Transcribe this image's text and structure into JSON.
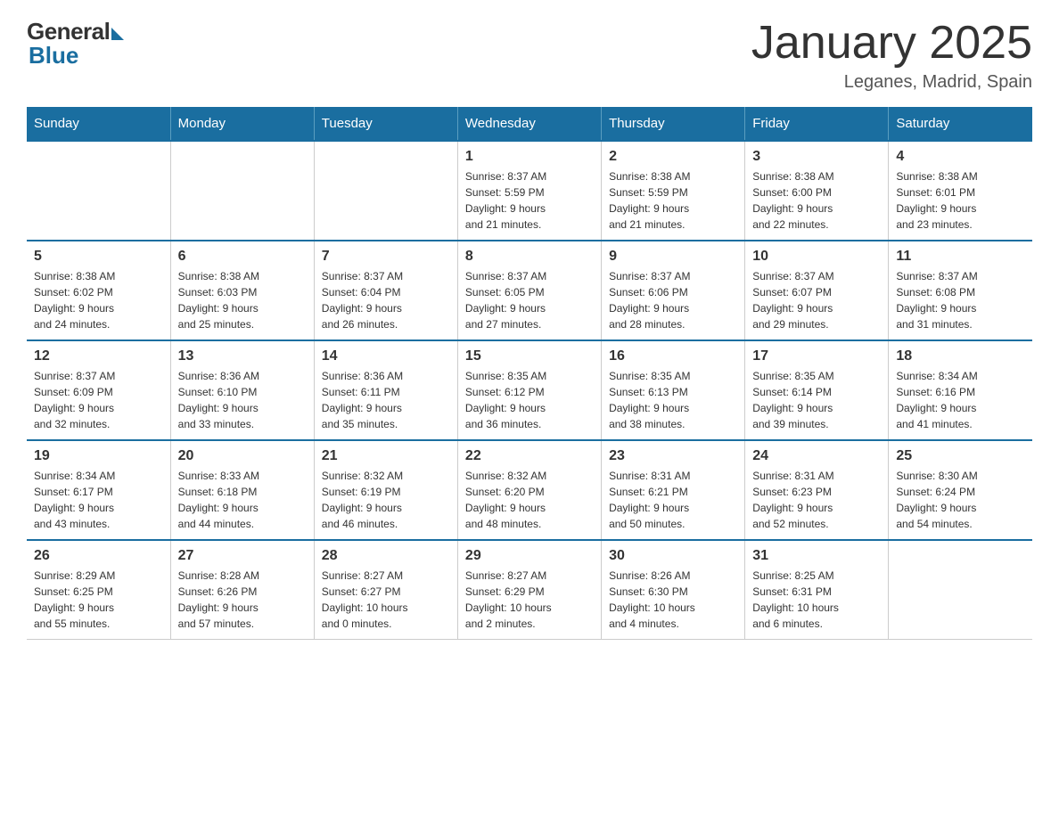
{
  "logo": {
    "general": "General",
    "blue": "Blue"
  },
  "title": "January 2025",
  "location": "Leganes, Madrid, Spain",
  "days_of_week": [
    "Sunday",
    "Monday",
    "Tuesday",
    "Wednesday",
    "Thursday",
    "Friday",
    "Saturday"
  ],
  "weeks": [
    [
      {
        "day": "",
        "info": ""
      },
      {
        "day": "",
        "info": ""
      },
      {
        "day": "",
        "info": ""
      },
      {
        "day": "1",
        "info": "Sunrise: 8:37 AM\nSunset: 5:59 PM\nDaylight: 9 hours\nand 21 minutes."
      },
      {
        "day": "2",
        "info": "Sunrise: 8:38 AM\nSunset: 5:59 PM\nDaylight: 9 hours\nand 21 minutes."
      },
      {
        "day": "3",
        "info": "Sunrise: 8:38 AM\nSunset: 6:00 PM\nDaylight: 9 hours\nand 22 minutes."
      },
      {
        "day": "4",
        "info": "Sunrise: 8:38 AM\nSunset: 6:01 PM\nDaylight: 9 hours\nand 23 minutes."
      }
    ],
    [
      {
        "day": "5",
        "info": "Sunrise: 8:38 AM\nSunset: 6:02 PM\nDaylight: 9 hours\nand 24 minutes."
      },
      {
        "day": "6",
        "info": "Sunrise: 8:38 AM\nSunset: 6:03 PM\nDaylight: 9 hours\nand 25 minutes."
      },
      {
        "day": "7",
        "info": "Sunrise: 8:37 AM\nSunset: 6:04 PM\nDaylight: 9 hours\nand 26 minutes."
      },
      {
        "day": "8",
        "info": "Sunrise: 8:37 AM\nSunset: 6:05 PM\nDaylight: 9 hours\nand 27 minutes."
      },
      {
        "day": "9",
        "info": "Sunrise: 8:37 AM\nSunset: 6:06 PM\nDaylight: 9 hours\nand 28 minutes."
      },
      {
        "day": "10",
        "info": "Sunrise: 8:37 AM\nSunset: 6:07 PM\nDaylight: 9 hours\nand 29 minutes."
      },
      {
        "day": "11",
        "info": "Sunrise: 8:37 AM\nSunset: 6:08 PM\nDaylight: 9 hours\nand 31 minutes."
      }
    ],
    [
      {
        "day": "12",
        "info": "Sunrise: 8:37 AM\nSunset: 6:09 PM\nDaylight: 9 hours\nand 32 minutes."
      },
      {
        "day": "13",
        "info": "Sunrise: 8:36 AM\nSunset: 6:10 PM\nDaylight: 9 hours\nand 33 minutes."
      },
      {
        "day": "14",
        "info": "Sunrise: 8:36 AM\nSunset: 6:11 PM\nDaylight: 9 hours\nand 35 minutes."
      },
      {
        "day": "15",
        "info": "Sunrise: 8:35 AM\nSunset: 6:12 PM\nDaylight: 9 hours\nand 36 minutes."
      },
      {
        "day": "16",
        "info": "Sunrise: 8:35 AM\nSunset: 6:13 PM\nDaylight: 9 hours\nand 38 minutes."
      },
      {
        "day": "17",
        "info": "Sunrise: 8:35 AM\nSunset: 6:14 PM\nDaylight: 9 hours\nand 39 minutes."
      },
      {
        "day": "18",
        "info": "Sunrise: 8:34 AM\nSunset: 6:16 PM\nDaylight: 9 hours\nand 41 minutes."
      }
    ],
    [
      {
        "day": "19",
        "info": "Sunrise: 8:34 AM\nSunset: 6:17 PM\nDaylight: 9 hours\nand 43 minutes."
      },
      {
        "day": "20",
        "info": "Sunrise: 8:33 AM\nSunset: 6:18 PM\nDaylight: 9 hours\nand 44 minutes."
      },
      {
        "day": "21",
        "info": "Sunrise: 8:32 AM\nSunset: 6:19 PM\nDaylight: 9 hours\nand 46 minutes."
      },
      {
        "day": "22",
        "info": "Sunrise: 8:32 AM\nSunset: 6:20 PM\nDaylight: 9 hours\nand 48 minutes."
      },
      {
        "day": "23",
        "info": "Sunrise: 8:31 AM\nSunset: 6:21 PM\nDaylight: 9 hours\nand 50 minutes."
      },
      {
        "day": "24",
        "info": "Sunrise: 8:31 AM\nSunset: 6:23 PM\nDaylight: 9 hours\nand 52 minutes."
      },
      {
        "day": "25",
        "info": "Sunrise: 8:30 AM\nSunset: 6:24 PM\nDaylight: 9 hours\nand 54 minutes."
      }
    ],
    [
      {
        "day": "26",
        "info": "Sunrise: 8:29 AM\nSunset: 6:25 PM\nDaylight: 9 hours\nand 55 minutes."
      },
      {
        "day": "27",
        "info": "Sunrise: 8:28 AM\nSunset: 6:26 PM\nDaylight: 9 hours\nand 57 minutes."
      },
      {
        "day": "28",
        "info": "Sunrise: 8:27 AM\nSunset: 6:27 PM\nDaylight: 10 hours\nand 0 minutes."
      },
      {
        "day": "29",
        "info": "Sunrise: 8:27 AM\nSunset: 6:29 PM\nDaylight: 10 hours\nand 2 minutes."
      },
      {
        "day": "30",
        "info": "Sunrise: 8:26 AM\nSunset: 6:30 PM\nDaylight: 10 hours\nand 4 minutes."
      },
      {
        "day": "31",
        "info": "Sunrise: 8:25 AM\nSunset: 6:31 PM\nDaylight: 10 hours\nand 6 minutes."
      },
      {
        "day": "",
        "info": ""
      }
    ]
  ]
}
